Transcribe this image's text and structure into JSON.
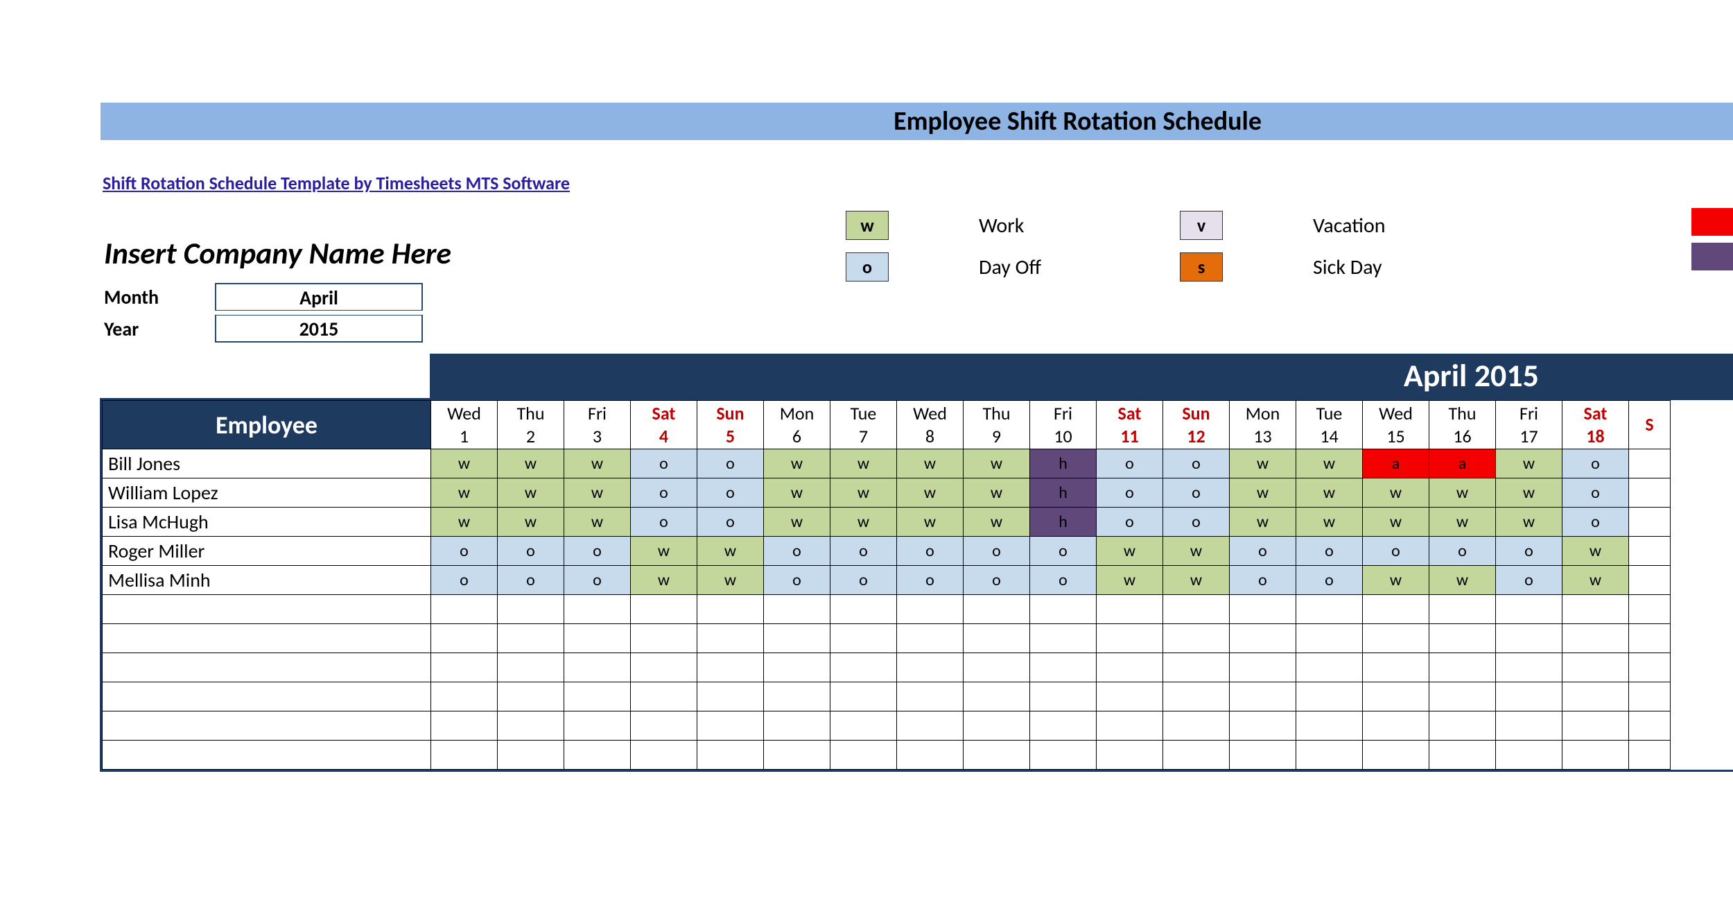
{
  "banner": {
    "title": "Employee Shift Rotation Schedule"
  },
  "templateLink": "Shift Rotation Schedule Template by Timesheets MTS Software",
  "company": "Insert Company Name Here",
  "meta": {
    "month_label": "Month",
    "year_label": "Year",
    "month": "April",
    "year": "2015"
  },
  "legend": {
    "w": {
      "code": "w",
      "text": "Work"
    },
    "o": {
      "code": "o",
      "text": "Day Off"
    },
    "v": {
      "code": "v",
      "text": "Vacation"
    },
    "s": {
      "code": "s",
      "text": "Sick Day"
    }
  },
  "month_bar": "April 2015",
  "employee_header": "Employee",
  "columns": [
    {
      "dow": "Wed",
      "dom": "1",
      "weekend": false
    },
    {
      "dow": "Thu",
      "dom": "2",
      "weekend": false
    },
    {
      "dow": "Fri",
      "dom": "3",
      "weekend": false
    },
    {
      "dow": "Sat",
      "dom": "4",
      "weekend": true
    },
    {
      "dow": "Sun",
      "dom": "5",
      "weekend": true
    },
    {
      "dow": "Mon",
      "dom": "6",
      "weekend": false
    },
    {
      "dow": "Tue",
      "dom": "7",
      "weekend": false
    },
    {
      "dow": "Wed",
      "dom": "8",
      "weekend": false
    },
    {
      "dow": "Thu",
      "dom": "9",
      "weekend": false
    },
    {
      "dow": "Fri",
      "dom": "10",
      "weekend": false
    },
    {
      "dow": "Sat",
      "dom": "11",
      "weekend": true
    },
    {
      "dow": "Sun",
      "dom": "12",
      "weekend": true
    },
    {
      "dow": "Mon",
      "dom": "13",
      "weekend": false
    },
    {
      "dow": "Tue",
      "dom": "14",
      "weekend": false
    },
    {
      "dow": "Wed",
      "dom": "15",
      "weekend": false
    },
    {
      "dow": "Thu",
      "dom": "16",
      "weekend": false
    },
    {
      "dow": "Fri",
      "dom": "17",
      "weekend": false
    },
    {
      "dow": "Sat",
      "dom": "18",
      "weekend": true
    },
    {
      "dow": "S",
      "dom": "",
      "weekend": true,
      "partial": true
    }
  ],
  "employees": [
    {
      "name": "Bill Jones",
      "codes": [
        "w",
        "w",
        "w",
        "o",
        "o",
        "w",
        "w",
        "w",
        "w",
        "h",
        "o",
        "o",
        "w",
        "w",
        "a",
        "a",
        "w",
        "o",
        ""
      ]
    },
    {
      "name": "William Lopez",
      "codes": [
        "w",
        "w",
        "w",
        "o",
        "o",
        "w",
        "w",
        "w",
        "w",
        "h",
        "o",
        "o",
        "w",
        "w",
        "w",
        "w",
        "w",
        "o",
        ""
      ]
    },
    {
      "name": "Lisa McHugh",
      "codes": [
        "w",
        "w",
        "w",
        "o",
        "o",
        "w",
        "w",
        "w",
        "w",
        "h",
        "o",
        "o",
        "w",
        "w",
        "w",
        "w",
        "w",
        "o",
        ""
      ]
    },
    {
      "name": "Roger Miller",
      "codes": [
        "o",
        "o",
        "o",
        "w",
        "w",
        "o",
        "o",
        "o",
        "o",
        "o",
        "w",
        "w",
        "o",
        "o",
        "o",
        "o",
        "o",
        "w",
        ""
      ]
    },
    {
      "name": "Mellisa Minh",
      "codes": [
        "o",
        "o",
        "o",
        "w",
        "w",
        "o",
        "o",
        "o",
        "o",
        "o",
        "w",
        "w",
        "o",
        "o",
        "w",
        "w",
        "o",
        "w",
        ""
      ]
    }
  ],
  "emptyRows": 6
}
